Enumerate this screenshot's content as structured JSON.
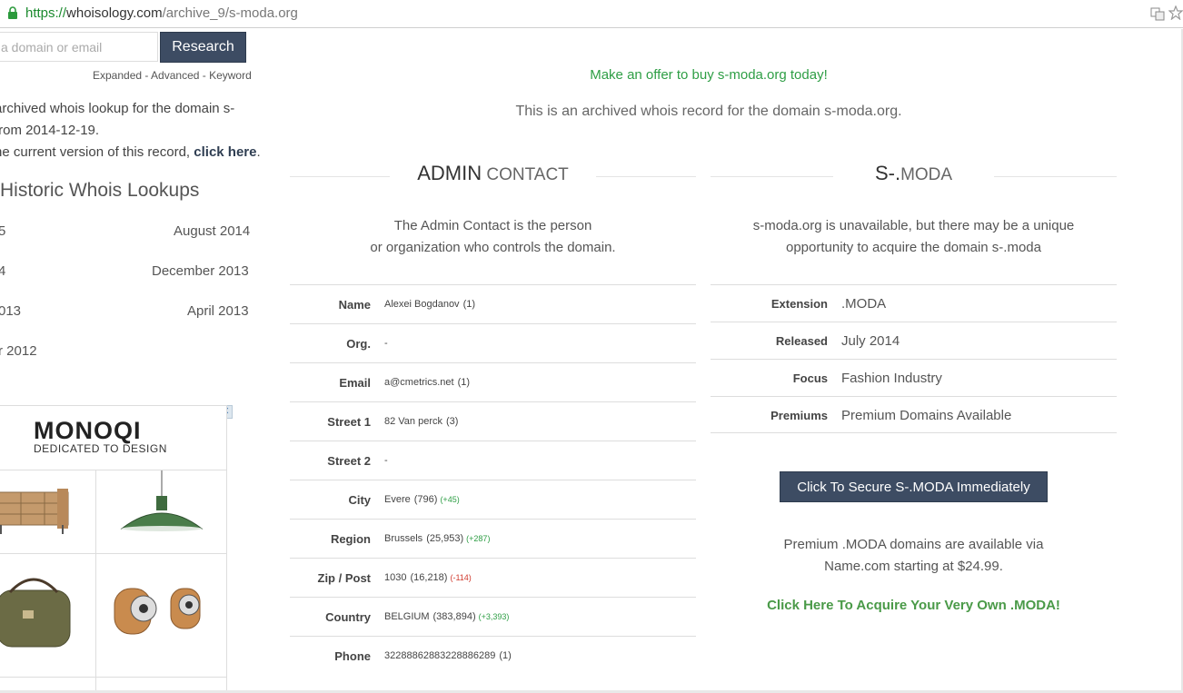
{
  "browser": {
    "url_scheme": "https://",
    "url_host": "whoisology.com",
    "url_path": "/archive_9/s-moda.org"
  },
  "sidebar": {
    "search_placeholder": "a domain or email",
    "research_label": "Research",
    "search_links": "Expanded - Advanced - Keyword",
    "intro_line1": "archived whois lookup for the domain s-",
    "intro_line2": "from 2014-12-19.",
    "intro_line3_prefix": "he current version of this record, ",
    "intro_link": "click here",
    "intro_line3_suffix": ".",
    "history_title": "Historic Whois Lookups",
    "history": [
      {
        "left": "5",
        "right": "August 2014"
      },
      {
        "left": "4",
        "right": "December 2013"
      },
      {
        "left": "013",
        "right": "April 2013"
      },
      {
        "left": "r 2012",
        "right": ""
      }
    ]
  },
  "ad": {
    "logo": "MONOQI",
    "tagline": "DEDICATED TO DESIGN",
    "badge_info": "▷",
    "badge_close": "✕"
  },
  "main": {
    "offer": "Make an offer to buy s-moda.org today!",
    "archived": "This is an archived whois record for the domain s-moda.org."
  },
  "admin": {
    "title_big": "ADMIN",
    "title_small": " CONTACT",
    "desc_line1": "The Admin Contact is the person",
    "desc_line2": "or organization who controls the domain.",
    "rows": [
      {
        "label": "Name",
        "value": "Alexei Bogdanov",
        "count": "(1)",
        "delta": "",
        "delta_dir": ""
      },
      {
        "label": "Org.",
        "value": "-",
        "count": "",
        "delta": "",
        "delta_dir": ""
      },
      {
        "label": "Email",
        "value": "a@cmetrics.net",
        "count": "(1)",
        "delta": "",
        "delta_dir": ""
      },
      {
        "label": "Street 1",
        "value": "82 Van perck",
        "count": "(3)",
        "delta": "",
        "delta_dir": ""
      },
      {
        "label": "Street 2",
        "value": "-",
        "count": "",
        "delta": "",
        "delta_dir": ""
      },
      {
        "label": "City",
        "value": "Evere",
        "count": "(796)",
        "delta": "(+45)",
        "delta_dir": "up"
      },
      {
        "label": "Region",
        "value": "Brussels",
        "count": "(25,953)",
        "delta": "(+287)",
        "delta_dir": "up"
      },
      {
        "label": "Zip / Post",
        "value": "1030",
        "count": "(16,218)",
        "delta": "(-114)",
        "delta_dir": "down"
      },
      {
        "label": "Country",
        "value": "BELGIUM",
        "count": "(383,894)",
        "delta": "(+3,393)",
        "delta_dir": "up"
      },
      {
        "label": "Phone",
        "value": "32288862883228886289",
        "count": "(1)",
        "delta": "",
        "delta_dir": ""
      }
    ]
  },
  "tld": {
    "title_big": "S-.",
    "title_small": "MODA",
    "desc_line1": "s-moda.org is unavailable, but there may be a unique",
    "desc_line2": "opportunity to acquire the domain s-.moda",
    "rows": [
      {
        "label": "Extension",
        "value": ".MODA"
      },
      {
        "label": "Released",
        "value": "July 2014"
      },
      {
        "label": "Focus",
        "value": "Fashion Industry"
      },
      {
        "label": "Premiums",
        "value": "Premium Domains Available"
      }
    ],
    "secure_button": "Click To Secure S-.MODA Immediately",
    "premium_line1": "Premium .MODA domains are available via",
    "premium_line2": "Name.com starting at $24.99.",
    "acquire_link": "Click Here To Acquire Your Very Own .MODA!"
  },
  "colors": {
    "accent_button": "#3d4c63",
    "green_link": "#2e9e45",
    "delta_up": "#2e9e45",
    "delta_down": "#d03a2e"
  }
}
